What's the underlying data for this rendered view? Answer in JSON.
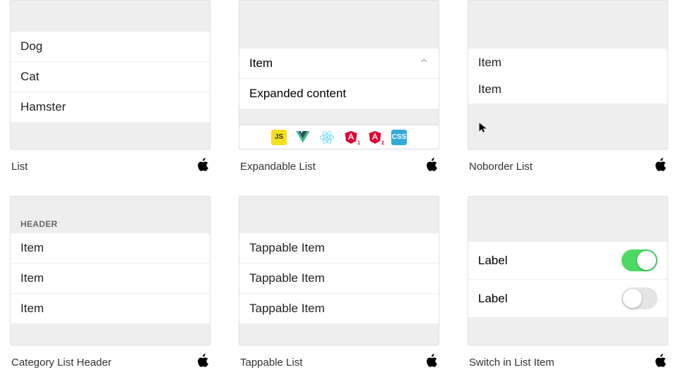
{
  "cards": {
    "list": {
      "caption": "List",
      "items": [
        "Dog",
        "Cat",
        "Hamster"
      ]
    },
    "expandable": {
      "caption": "Expandable List",
      "row": "Item",
      "content": "Expanded content",
      "badges": [
        "js",
        "vue",
        "react",
        "ang1",
        "ang2",
        "css"
      ],
      "badge_labels": {
        "js": "JS",
        "css": "CSS"
      }
    },
    "noborder": {
      "caption": "Noborder List",
      "items": [
        "Item",
        "Item"
      ]
    },
    "header": {
      "caption": "Category List Header",
      "header": "HEADER",
      "items": [
        "Item",
        "Item",
        "Item"
      ]
    },
    "tappable": {
      "caption": "Tappable List",
      "items": [
        "Tappable Item",
        "Tappable Item",
        "Tappable Item"
      ]
    },
    "switch": {
      "caption": "Switch in List Item",
      "rows": [
        {
          "label": "Label",
          "on": true
        },
        {
          "label": "Label",
          "on": false
        }
      ]
    }
  }
}
